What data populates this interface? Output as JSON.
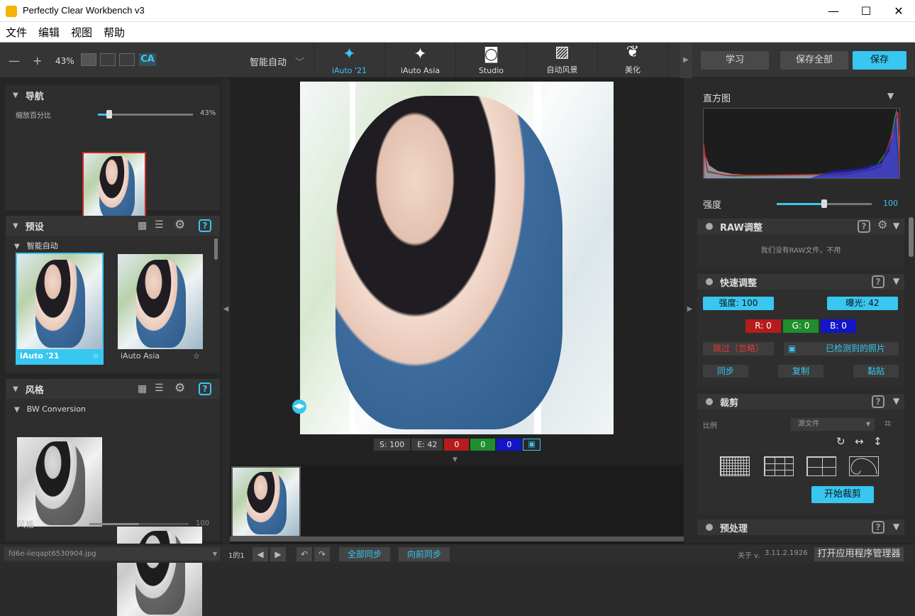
{
  "window": {
    "title": "Perfectly Clear Workbench v3",
    "minimize": "—",
    "maximize": "☐",
    "close": "✕"
  },
  "menu": [
    "文件",
    "编辑",
    "视图",
    "帮助"
  ],
  "toolbar": {
    "zoom_out": "—",
    "zoom_in": "+",
    "zoom_value": "43%",
    "ca_label": "CA",
    "preset_dropdown": "智能自动",
    "modes": [
      {
        "label": "iAuto '21",
        "icon": "magic-wand-icon"
      },
      {
        "label": "iAuto Asia",
        "icon": "magic-wand-icon"
      },
      {
        "label": "Studio",
        "icon": "portrait-icon"
      },
      {
        "label": "自动风景",
        "icon": "landscape-icon"
      },
      {
        "label": "美化",
        "icon": "beautify-icon"
      }
    ],
    "learn": "学习",
    "save_all": "保存全部",
    "save": "保存"
  },
  "navigator": {
    "title": "导航",
    "zoom_label": "缩放百分比",
    "zoom_value": "43%",
    "zoom_fraction": 0.12
  },
  "presets": {
    "title": "预设",
    "group": "智能自动",
    "items": [
      {
        "label": "iAuto '21"
      },
      {
        "label": "iAuto Asia"
      }
    ]
  },
  "styles": {
    "title": "风格",
    "group": "BW Conversion",
    "strength_label": "风格",
    "strength_value": "100"
  },
  "canvas": {
    "badges": {
      "s": "S: 100",
      "e": "E: 42",
      "r": "0",
      "g": "0",
      "b": "0"
    }
  },
  "right": {
    "histogram_title": "直方图",
    "strength_label": "强度",
    "strength_value": "100",
    "strength_fraction": 0.5,
    "raw": {
      "title": "RAW调整",
      "message": "我们没有RAW文件，不用"
    },
    "quick": {
      "title": "快速调整",
      "strength": "强度: 100",
      "exposure": "曝光: 42",
      "r": "R: 0",
      "g": "G: 0",
      "b": "B: 0",
      "skip": "跳过（忽略）",
      "detected": "已检测到的照片",
      "sync": "同步",
      "copy": "复制",
      "paste": "黏贴"
    },
    "crop": {
      "title": "裁剪",
      "ratio_label": "比例",
      "ratio_value": "源文件",
      "start": "开始裁剪"
    },
    "preprocess": {
      "title": "预处理"
    }
  },
  "status": {
    "filename": "fd6e-iieqapt6530904.jpg",
    "page": "1的1",
    "sync_all": "全部同步",
    "sync_forward": "向前同步",
    "about": "关于 v.",
    "version": "3.11.2.1926",
    "open_manager": "打开应用程序管理器"
  },
  "colors": {
    "accent": "#37c7f1",
    "red": "#b71c1c",
    "green": "#1e8e2e",
    "blue": "#1414c8"
  }
}
